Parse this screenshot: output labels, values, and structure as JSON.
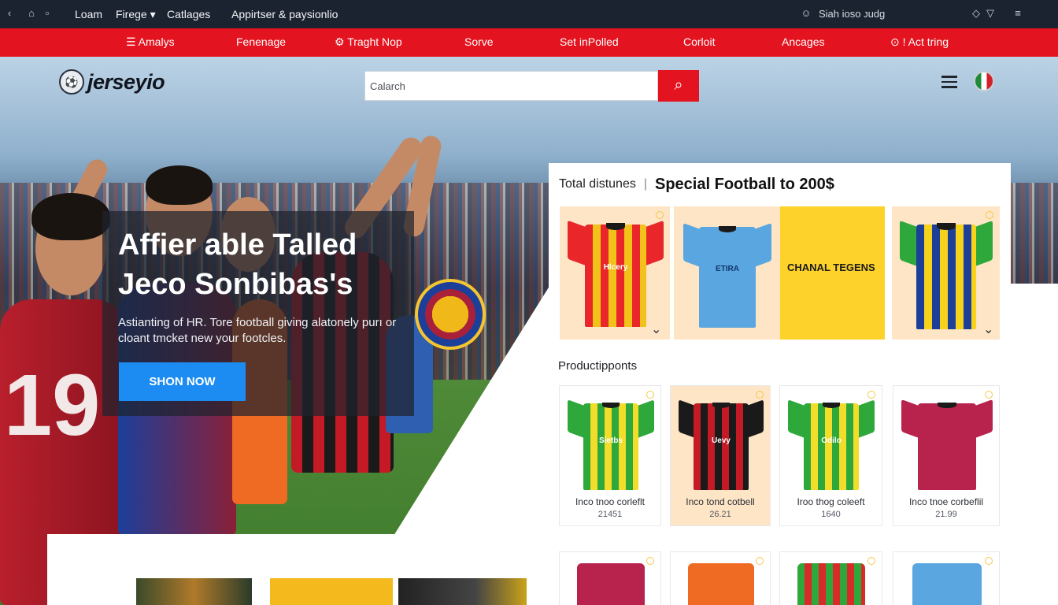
{
  "topbar": {
    "items": [
      "Loam",
      "Fіrege",
      "Catlages",
      "Appirtser & paysionlio"
    ],
    "dropdown_glyph": "▾",
    "user_label": "Siah ioso ᴊudg"
  },
  "nav": {
    "items": [
      "Amalys",
      "Fenenage",
      "Traght Nop",
      "Sorve",
      "Set inPolled",
      "Corloit",
      "Ancages",
      "Act tring"
    ]
  },
  "brand": {
    "name": "jerseyio"
  },
  "search": {
    "placeholder": "Calarch"
  },
  "hero": {
    "title_line1": "Affier able Talled",
    "title_line2": "Jeco Sonbibas's",
    "subtitle": "Astianting of HR. Tore football giving alatonely purı or cloant tmcket new your footcles.",
    "cta": "SHON NOW",
    "player_number": "19"
  },
  "promo": {
    "small_label": "Total distunes",
    "title": "Special Football to 200$",
    "banner_text": "CHANAL TEGENS",
    "tiles": [
      {
        "color_primary": "#e9262a",
        "color_secondary": "#f3c21a",
        "brand": "Hlcery"
      },
      {
        "color_primary": "#5aa6e0",
        "color_secondary": "#5aa6e0",
        "brand": "ETIRA"
      },
      {
        "color_primary": "#1c3f9a",
        "color_secondary": "#f6d21b",
        "brand": ""
      }
    ]
  },
  "products": {
    "section_title": "Productipponts",
    "row1": [
      {
        "name": "Inco tnoo corleflt",
        "price": "21451",
        "primary": "#2fa83b",
        "secondary": "#f2dd2a",
        "brand": "Sietbs"
      },
      {
        "name": "Inco tond cotbell",
        "price": "26.21",
        "primary": "#c41a26",
        "secondary": "#1a1a1a",
        "brand": "Uevy"
      },
      {
        "name": "Iroo thog coleeft",
        "price": "1640",
        "primary": "#2fa83b",
        "secondary": "#f2dd2a",
        "brand": "Odilo"
      },
      {
        "name": "Inco tnoe corbeflil",
        "price": "21.99",
        "primary": "#b8234e",
        "secondary": "#b8234e",
        "brand": ""
      }
    ],
    "row2": [
      {
        "primary": "#b8234e",
        "secondary": "#b8234e"
      },
      {
        "primary": "#ef6a22",
        "secondary": "#ef6a22"
      },
      {
        "primary": "#2fa83b",
        "secondary": "#d92a2a"
      },
      {
        "primary": "#5aa6e0",
        "secondary": "#5aa6e0"
      }
    ]
  },
  "colors": {
    "accent": "#e3131f",
    "cta": "#1d8cf2"
  }
}
